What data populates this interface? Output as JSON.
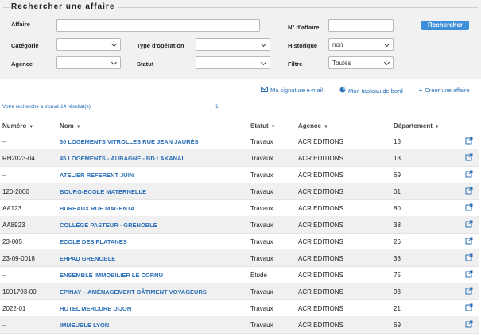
{
  "search": {
    "title": "Rechercher une affaire",
    "labels": {
      "affaire": "Affaire",
      "num_affaire": "N° d'affaire",
      "categorie": "Catégorie",
      "type_operation": "Type d'opération",
      "historique": "Historique",
      "agence": "Agence",
      "statut": "Statut",
      "filtre": "Filtre"
    },
    "values": {
      "affaire": "",
      "num_affaire": "",
      "categorie": "",
      "type_operation": "",
      "historique": "non",
      "agence": "",
      "statut": "",
      "filtre": "Toutes"
    },
    "button": "Rechercher"
  },
  "actions": {
    "signature": "Ma signature e-mail",
    "dashboard": "Mon tableau de bord",
    "create": "Créer une affaire"
  },
  "results": {
    "count_text": "Votre recherche a trouvé 14 résultat(s)",
    "page": "1"
  },
  "table": {
    "headers": {
      "numero": "Numéro",
      "nom": "Nom",
      "statut": "Statut",
      "agence": "Agence",
      "departement": "Département"
    },
    "rows": [
      {
        "numero": "--",
        "nom": "30 LOGEMENTS VITROLLES RUE JEAN JAURÈS",
        "statut": "Travaux",
        "agence": "ACR EDITIONS",
        "departement": "13"
      },
      {
        "numero": "RH2023-04",
        "nom": "45 LOGEMENTS - AUBAGNE - BD LAKANAL",
        "statut": "Travaux",
        "agence": "ACR EDITIONS",
        "departement": "13"
      },
      {
        "numero": "--",
        "nom": "ATELIER REFERENT JUIN",
        "statut": "Travaux",
        "agence": "ACR EDITIONS",
        "departement": "69"
      },
      {
        "numero": "120-2000",
        "nom": "BOURG-ECOLE MATERNELLE",
        "statut": "Travaux",
        "agence": "ACR EDITIONS",
        "departement": "01"
      },
      {
        "numero": "AA123",
        "nom": "BUREAUX RUE MAGENTA",
        "statut": "Travaux",
        "agence": "ACR EDITIONS",
        "departement": "80"
      },
      {
        "numero": "AA8923",
        "nom": "COLLÈGE PASTEUR - GRENOBLE",
        "statut": "Travaux",
        "agence": "ACR EDITIONS",
        "departement": "38"
      },
      {
        "numero": "23-005",
        "nom": "ECOLE DES PLATANES",
        "statut": "Travaux",
        "agence": "ACR EDITIONS",
        "departement": "26"
      },
      {
        "numero": "23-09-0018",
        "nom": "EHPAD GRENOBLE",
        "statut": "Travaux",
        "agence": "ACR EDITIONS",
        "departement": "38"
      },
      {
        "numero": "--",
        "nom": "ENSEMBLE IMMOBILIER LE CORNU",
        "statut": "Étude",
        "agence": "ACR EDITIONS",
        "departement": "75"
      },
      {
        "numero": "1001793-00",
        "nom": "EPINAY – AMÉNAGEMENT BÂTIMENT VOYAGEURS",
        "statut": "Travaux",
        "agence": "ACR EDITIONS",
        "departement": "93"
      },
      {
        "numero": "2022-01",
        "nom": "HOTEL MERCURE DIJON",
        "statut": "Travaux",
        "agence": "ACR EDITIONS",
        "departement": "21"
      },
      {
        "numero": "--",
        "nom": "IMMEUBLE LYON",
        "statut": "Travaux",
        "agence": "ACR EDITIONS",
        "departement": "69"
      }
    ]
  },
  "icons": {
    "external_link": "external-link-icon",
    "mail": "mail-icon",
    "dashboard": "pie-chart-icon",
    "plus": "plus-icon"
  },
  "colors": {
    "link": "#2b6fb6",
    "button": "#3d8fd9",
    "panel": "#f1f1f1",
    "row_alt": "#f0f0f0"
  }
}
